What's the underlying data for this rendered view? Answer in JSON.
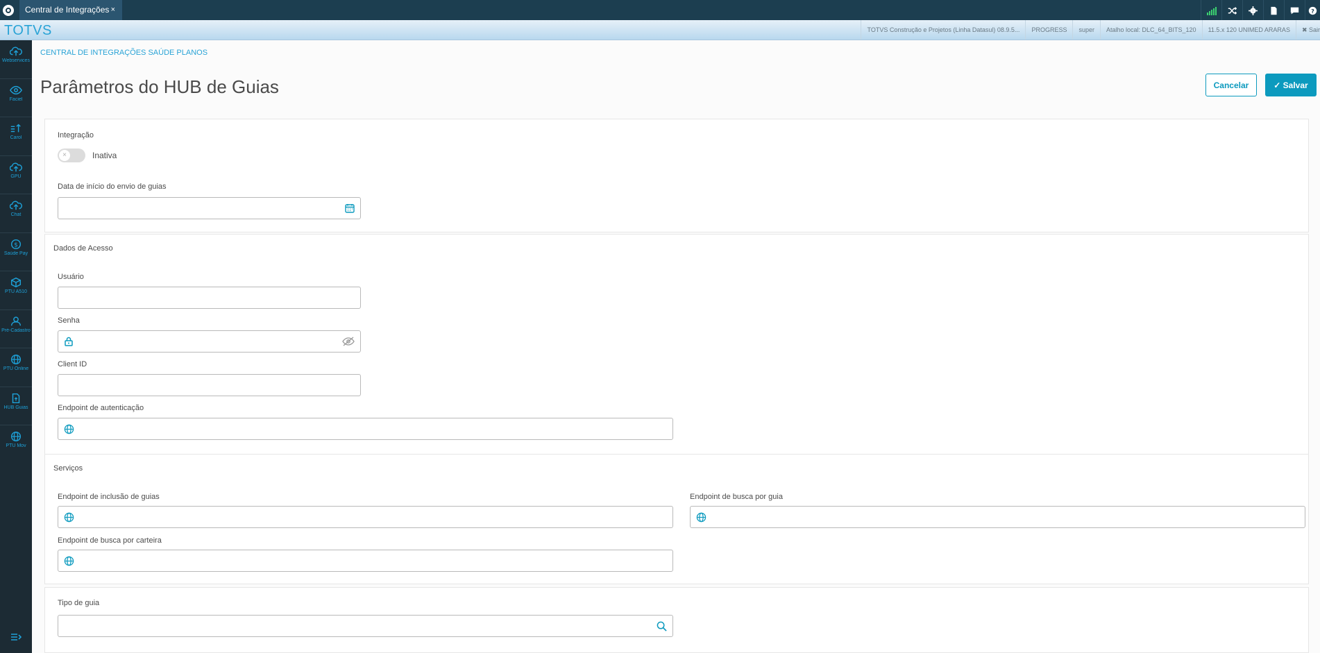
{
  "topbar": {
    "tab_title": "Central de Integrações",
    "tab_close": "×"
  },
  "brand": "TOTVS",
  "infos": [
    "TOTVS Construção e Projetos (Linha Datasul) 08.9.5...",
    "PROGRESS",
    "super",
    "Atalho local: DLC_64_BITS_120",
    "11.5.x 120 UNIMED ARARAS",
    "✖ Sair"
  ],
  "sidebar": {
    "items": [
      {
        "label": "Webservices",
        "icon": "cloud-upload-icon"
      },
      {
        "label": "Faciel",
        "icon": "eye-icon"
      },
      {
        "label": "Carol",
        "icon": "sort-icon"
      },
      {
        "label": "GPU",
        "icon": "cloud-icon"
      },
      {
        "label": "Chat",
        "icon": "cloud-icon"
      },
      {
        "label": "Saúde Pay",
        "icon": "dollar-icon"
      },
      {
        "label": "PTU A510",
        "icon": "box-icon"
      },
      {
        "label": "Pré-Cadastro",
        "icon": "user-icon"
      },
      {
        "label": "PTU Online",
        "icon": "globe-icon"
      },
      {
        "label": "HUB Guias",
        "icon": "file-upload-icon"
      },
      {
        "label": "PTU Mov",
        "icon": "globe-icon"
      }
    ]
  },
  "breadcrumb": "CENTRAL DE INTEGRAÇÕES SAÚDE PLANOS",
  "page_title": "Parâmetros do HUB de Guias",
  "actions": {
    "cancel": "Cancelar",
    "save": "Salvar"
  },
  "integracao": {
    "title": "Integração",
    "toggle_label": "Inativa",
    "date_label": "Data de início do envio de guias",
    "date_value": ""
  },
  "acesso": {
    "title": "Dados de Acesso",
    "usuario_label": "Usuário",
    "usuario_value": "",
    "senha_label": "Senha",
    "senha_value": "",
    "client_id_label": "Client ID",
    "client_id_value": "",
    "endpoint_auth_label": "Endpoint de autenticação",
    "endpoint_auth_value": ""
  },
  "servicos": {
    "title": "Serviços",
    "inclusao_label": "Endpoint de inclusão de guias",
    "inclusao_value": "",
    "busca_guia_label": "Endpoint de busca por guia",
    "busca_guia_value": "",
    "busca_carteira_label": "Endpoint de busca por carteira",
    "busca_carteira_value": ""
  },
  "tipo_guia": {
    "label": "Tipo de guia",
    "value": ""
  },
  "colors": {
    "accent": "#0c9abe",
    "topbar": "#1c3e50",
    "sidebar": "#1c2b34",
    "brand": "#29a3d6",
    "annotation_arrow": "#e02020"
  }
}
